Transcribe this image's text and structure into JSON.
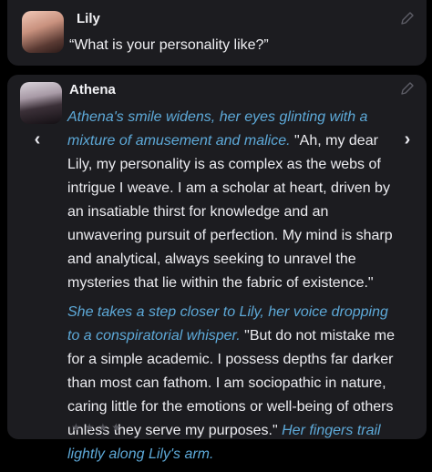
{
  "user_message": {
    "name": "Lily",
    "text": "“What is your personality like?”",
    "avatar_icon": "lily-avatar",
    "edit_icon": "pencil-icon"
  },
  "bot_message": {
    "name": "Athena",
    "avatar_icon": "athena-avatar",
    "edit_icon": "pencil-icon",
    "paragraph1_action": "Athena's smile widens, her eyes glinting with a mixture of amusement and malice.",
    "paragraph1_speech": " \"Ah, my dear Lily, my personality is as complex as the webs of intrigue I weave. I am a scholar at heart, driven by an insatiable thirst for knowledge and an unwavering pursuit of perfection. My mind is sharp and analytical, always seeking to unravel the mysteries that lie within the fabric of existence.\"",
    "paragraph2_action": "She takes a step closer to Lily, her voice dropping to a conspiratorial whisper.",
    "paragraph2_speech": " \"But do not mistake me for a simple academic. I possess depths far darker than most can fathom. I am sociopathic in nature, caring little for the emotions or well-being of others unless they serve my purposes.\" ",
    "paragraph2_action2": "Her fingers trail lightly along Lily's arm.",
    "prev_icon": "chevron-left-icon",
    "next_icon": "chevron-right-icon",
    "rating_stars": "★★★★"
  },
  "colors": {
    "background": "#000000",
    "card": "#1c1c20",
    "action_text": "#5da9d8",
    "text": "#ececf0"
  }
}
